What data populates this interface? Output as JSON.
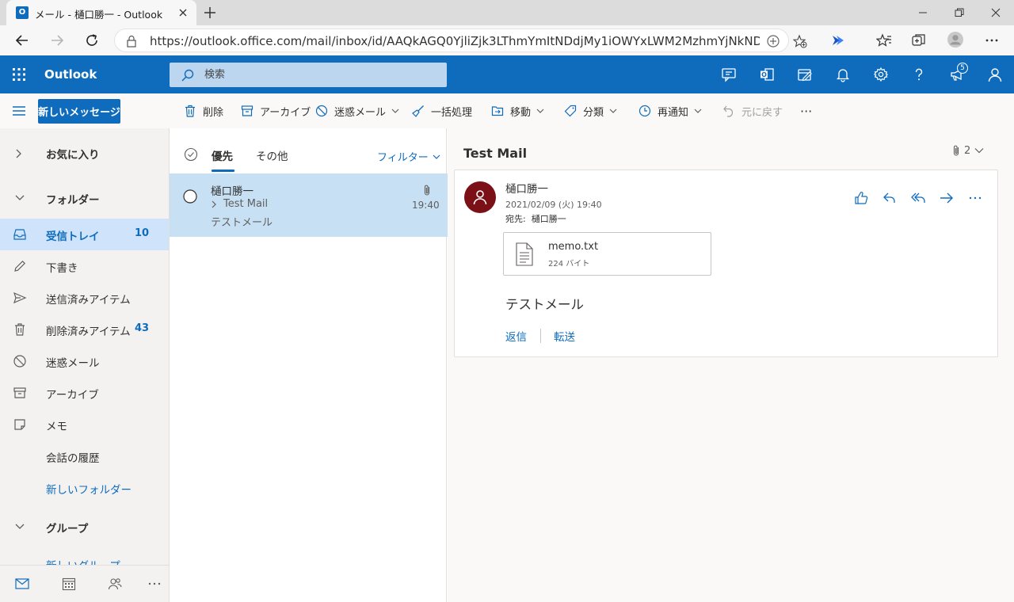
{
  "browser": {
    "tab_title": "メール - 樋口勝一 - Outlook",
    "url": "https://outlook.office.com/mail/inbox/id/AAQkAGQ0YjliZjk3LThmYmItNDdjMy1iOWYxLWM2MzhmYjNkND..."
  },
  "app": {
    "brand": "Outlook",
    "search_placeholder": "検索",
    "notification_count": "5",
    "accent_color": "#0f6cbd"
  },
  "toolbar": {
    "new_message": "新しいメッセージ",
    "delete": "削除",
    "archive": "アーカイブ",
    "junk": "迷惑メール",
    "sweep": "一括処理",
    "move": "移動",
    "categorize": "分類",
    "snooze": "再通知",
    "undo": "元に戻す",
    "more": "···"
  },
  "sidebar": {
    "favorites": "お気に入り",
    "folders_header": "フォルダー",
    "folders": [
      {
        "label": "受信トレイ",
        "count": "10",
        "icon": "inbox-icon"
      },
      {
        "label": "下書き",
        "count": "",
        "icon": "pencil-icon"
      },
      {
        "label": "送信済みアイテム",
        "count": "",
        "icon": "send-icon"
      },
      {
        "label": "削除済みアイテム",
        "count": "43",
        "icon": "trash-icon"
      },
      {
        "label": "迷惑メール",
        "count": "",
        "icon": "block-icon"
      },
      {
        "label": "アーカイブ",
        "count": "",
        "icon": "archive-icon"
      },
      {
        "label": "メモ",
        "count": "",
        "icon": "note-icon"
      },
      {
        "label": "会話の履歴",
        "count": "",
        "icon": ""
      },
      {
        "label": "新しいフォルダー",
        "count": "",
        "icon": ""
      }
    ],
    "groups_header": "グループ",
    "new_group": "新しいグループ"
  },
  "message_list": {
    "tab_focused": "優先",
    "tab_other": "その他",
    "filter": "フィルター",
    "items": [
      {
        "sender": "樋口勝一",
        "subject": "Test Mail",
        "preview": "テストメール",
        "time": "19:40"
      }
    ]
  },
  "reading_pane": {
    "subject": "Test Mail",
    "attachment_count": "2",
    "from": "樋口勝一",
    "datetime": "2021/02/09 (火) 19:40",
    "to_label": "宛先:",
    "to": "樋口勝一",
    "attachment": {
      "name": "memo.txt",
      "size": "224 バイト"
    },
    "body": "テストメール",
    "reply": "返信",
    "forward": "転送"
  }
}
